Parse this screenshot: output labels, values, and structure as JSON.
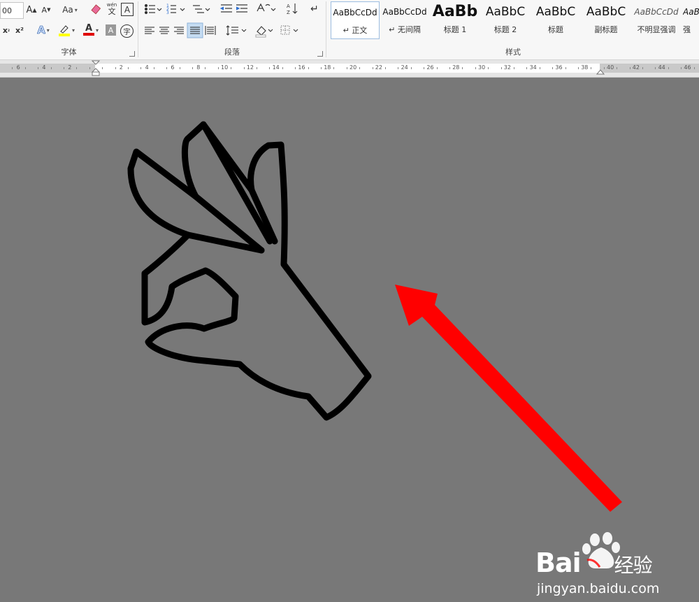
{
  "font_group": {
    "label": "字体",
    "font_size_value": "00",
    "grow_font_label": "A",
    "shrink_font_label": "A",
    "change_case_label": "Aa",
    "phonetic_label": "wén",
    "phonetic_label_char": "文",
    "border_char": "A",
    "subscript_label": "x",
    "superscript_label": "x²",
    "text_effect_label": "A",
    "font_color_label": "A",
    "char_shading_label": "A",
    "enclose_char": "字"
  },
  "paragraph_group": {
    "label": "段落"
  },
  "styles_group": {
    "label": "样式",
    "items": [
      {
        "sample": "AaBbCcDd",
        "name": "↵ 正文"
      },
      {
        "sample": "AaBbCcDd",
        "name": "↵ 无间隔"
      },
      {
        "sample": "AaBb",
        "name": "标题 1"
      },
      {
        "sample": "AaBbC",
        "name": "标题 2"
      },
      {
        "sample": "AaBbC",
        "name": "标题"
      },
      {
        "sample": "AaBbC",
        "name": "副标题"
      },
      {
        "sample": "AaBbCcDd",
        "name": "不明显强调"
      },
      {
        "sample": "AaB",
        "name": "强"
      }
    ]
  },
  "ruler": {
    "left_labels": [
      "6",
      "4",
      "2"
    ],
    "right_labels": [
      "2",
      "4",
      "6",
      "8",
      "10",
      "12",
      "14",
      "16",
      "18",
      "20",
      "22",
      "24",
      "26",
      "28",
      "30",
      "32",
      "34",
      "36",
      "38",
      "40",
      "42",
      "44",
      "46"
    ]
  },
  "watermark": {
    "brand_left": "Bai",
    "brand_right": "经验",
    "url": "jingyan.baidu.com"
  },
  "colors": {
    "canvas": "#787878",
    "arrow": "#ff0000",
    "highlight_yellow": "#ffff00",
    "font_red": "#e00000"
  }
}
